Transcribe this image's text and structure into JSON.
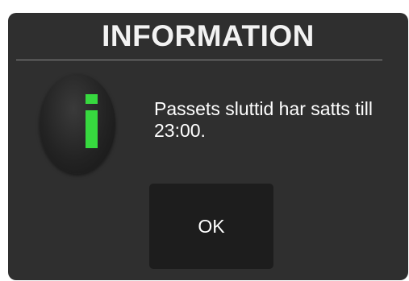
{
  "dialog": {
    "title": "INFORMATION",
    "icon": "info-icon",
    "message": "Passets sluttid har satts till 23:00.",
    "ok_label": "OK"
  },
  "colors": {
    "background": "#2f2f2f",
    "button": "#1d1d1d",
    "accent": "#37d93f",
    "text": "#ffffff"
  }
}
